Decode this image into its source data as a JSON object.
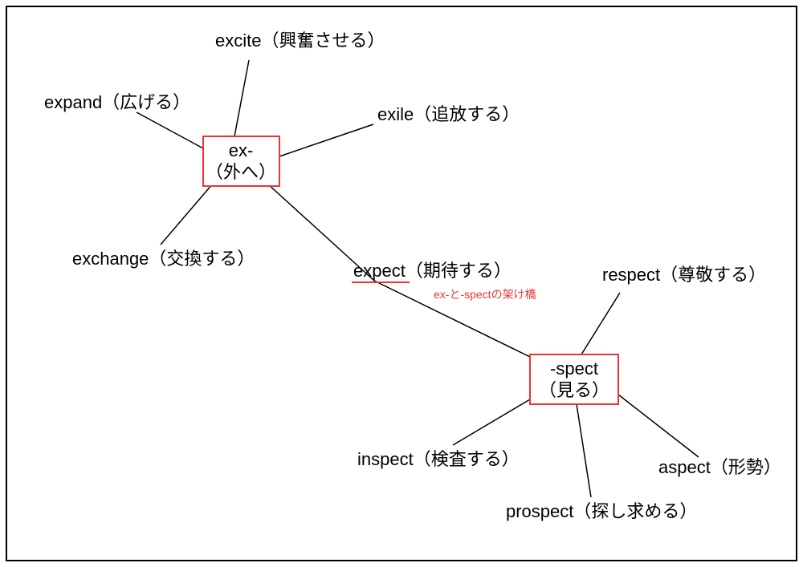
{
  "roots": {
    "ex": {
      "l1": "ex-",
      "l2": "（外へ）"
    },
    "spect": {
      "l1": "-spect",
      "l2": "（見る）"
    }
  },
  "bridge": {
    "word": "expect（期待する）",
    "word_underline_only": "expect",
    "note": "ex-と-spectの架け橋"
  },
  "leaves": {
    "excite": "excite（興奮させる）",
    "expand": "expand（広げる）",
    "exile": "exile（追放する）",
    "exchange": "exchange（交換する）",
    "respect": "respect（尊敬する）",
    "inspect": "inspect（検査する）",
    "aspect": "aspect（形勢）",
    "prospect": "prospect（探し求める）"
  }
}
